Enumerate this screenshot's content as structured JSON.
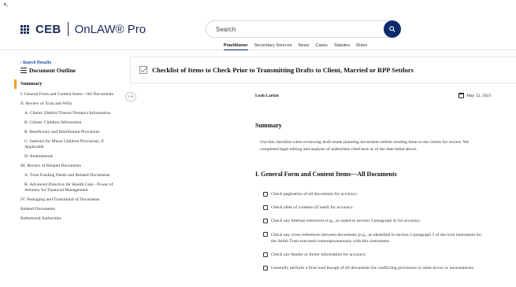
{
  "header": {
    "brand": "CEB",
    "product": "OnLAW® Pro",
    "search": {
      "placeholder": "Search",
      "value": ""
    },
    "nav": [
      "Practitioner",
      "Secondary Sources",
      "News",
      "Cases",
      "Statutes",
      "Rules"
    ],
    "active_nav": "Practitioner"
  },
  "sidebar": {
    "back_link": "‹ Search Results",
    "title": "Document Outline",
    "summary_label": "Summary",
    "items": [
      {
        "label": "I. General Form and Content Items—All Documents",
        "level": 0
      },
      {
        "label": "II. Review of Trust and Wills",
        "level": 0
      },
      {
        "label": "A. Clients' (Settlor/Trustor/Testator) Information",
        "level": 1
      },
      {
        "label": "B. Clients' Children Information",
        "level": 1
      },
      {
        "label": "B. Beneficiary and Distribution Provisions",
        "level": 1
      },
      {
        "label": "C. Subtrust for Minor Children Provisions, if Applicable",
        "level": 1
      },
      {
        "label": "D. Amendments",
        "level": 1
      },
      {
        "label": "III. Review of Related Documents",
        "level": 0
      },
      {
        "label": "A. Trust Funding Deeds and Related Documents",
        "level": 1
      },
      {
        "label": "B. Advanced Directive for Health Care - Power of Attorney for Financial Management",
        "level": 1
      },
      {
        "label": "IV. Packaging and Transmittal of Documents",
        "level": 0
      },
      {
        "label": "Related Documents",
        "level": 0
      },
      {
        "label": "Referenced Authorities",
        "level": 0
      }
    ]
  },
  "document": {
    "title": "Checklist of Items to Check Prior to Transmitting Drafts to Client, Married or RPP Settlors",
    "author": "Leah Larkin",
    "date": "May 12, 2023",
    "summary_heading": "Summary",
    "summary_text": "Use this checklist when reviewing draft estate planning documents before sending them to the clients for review. We completed legal editing and analysis of authorities cited here as of the date listed above.",
    "section_heading": "I. General Form and Content Items—All Documents",
    "checklist": [
      "Check pagination of all documents for accuracy.",
      "Check table of contents (if used) for accuracy.",
      "Check any internal references (e.g., as stated in section 3 paragraph 4) for accuracy.",
      "Check any cross-references between documents (e.g., as identified in section 2 paragraph 5 of the trust instrument for the Smith Trust executed contemporaneously with this instrument.",
      "Check any header or footer information for accuracy.",
      "Generally perform a final read though of all documents for conflicting provisions or other errors or inconstancies."
    ]
  },
  "colors": {
    "brand_navy": "#1a2a5a",
    "search_button": "#0d2a6b",
    "summary_marker": "#f0a020",
    "link_blue": "#1e4aa8"
  },
  "icons": [
    "grid-menu-icon",
    "search-icon",
    "list-icon",
    "checkbox-doc-icon",
    "calendar-icon",
    "expand-icon"
  ]
}
